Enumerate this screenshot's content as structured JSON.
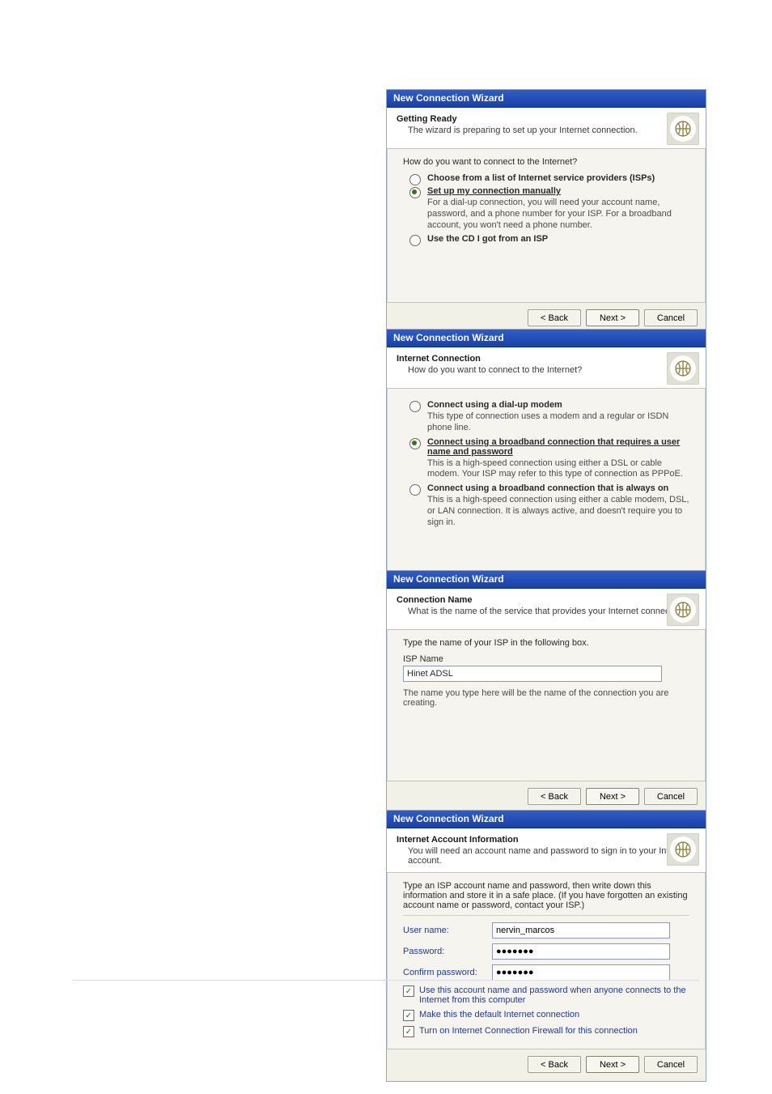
{
  "wizard_title": "New Connection Wizard",
  "buttons": {
    "back": "< Back",
    "next": "Next >",
    "cancel": "Cancel"
  },
  "panel1": {
    "title": "Getting Ready",
    "sub": "The wizard is preparing to set up your Internet connection.",
    "question": "How do you want to connect to the Internet?",
    "opt_a": "Choose from a list of Internet service providers (ISPs)",
    "opt_b": "Set up my connection manually",
    "opt_b_desc": "For a dial-up connection, you will need your account name, password, and a phone number for your ISP. For a broadband account, you won't need a phone number.",
    "opt_c": "Use the CD I got from an ISP"
  },
  "panel2": {
    "title": "Internet Connection",
    "sub": "How do you want to connect to the Internet?",
    "opt_a": "Connect using a dial-up modem",
    "opt_a_desc": "This type of connection uses a modem and a regular or ISDN phone line.",
    "opt_b": "Connect using a broadband connection that requires a user name and password",
    "opt_b_desc": "This is a high-speed connection using either a DSL or cable modem. Your ISP may refer to this type of connection as PPPoE.",
    "opt_c": "Connect using a broadband connection that is always on",
    "opt_c_desc": "This is a high-speed connection using either a cable modem, DSL, or LAN connection. It is always active, and doesn't require you to sign in."
  },
  "panel3": {
    "title": "Connection Name",
    "sub": "What is the name of the service that provides your Internet connection?",
    "prompt": "Type the name of your ISP in the following box.",
    "label": "ISP Name",
    "value": "Hinet ADSL",
    "note": "The name you type here will be the name of the connection you are creating."
  },
  "panel4": {
    "title": "Internet Account Information",
    "sub": "You will need an account name and password to sign in to your Internet account.",
    "intro": "Type an ISP account name and password, then write down this information and store it in a safe place. (If you have forgotten an existing account name or password, contact your ISP.)",
    "user_label": "User name:",
    "user_value": "nervin_marcos",
    "pass_label": "Password:",
    "pass_value": "●●●●●●●",
    "conf_label": "Confirm password:",
    "conf_value": "●●●●●●●",
    "chk1": "Use this account name and password when anyone connects to the Internet from this computer",
    "chk2": "Make this the default Internet connection",
    "chk3": "Turn on Internet Connection Firewall for this connection"
  }
}
